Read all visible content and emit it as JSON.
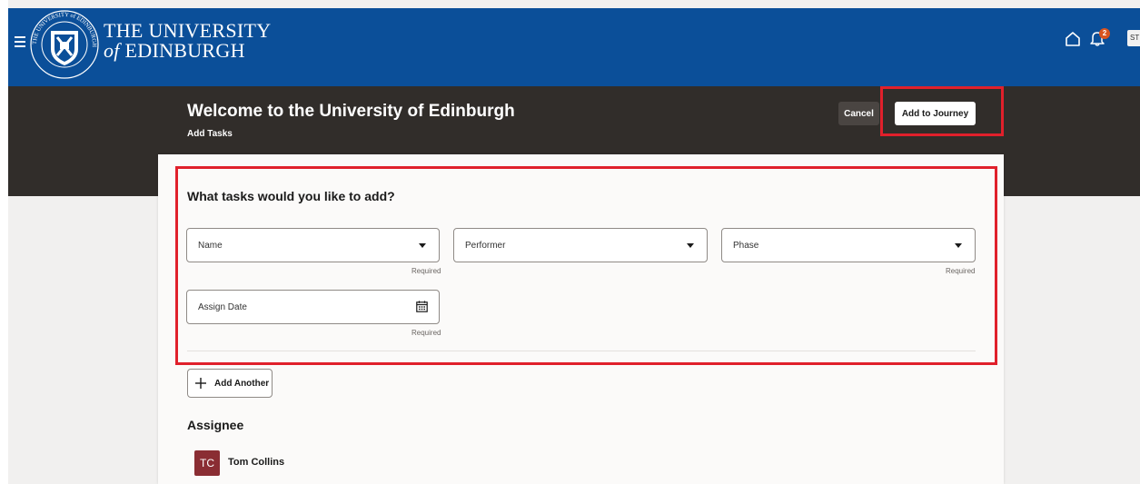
{
  "header": {
    "brand_line1": "THE UNIVERSITY",
    "brand_of": "of",
    "brand_line2": "EDINBURGH",
    "crest_text": "THE UNIVERSITY of EDINBURGH",
    "notification_count": "2",
    "user_initials": "ST",
    "colors": {
      "header_bg": "#0b4f99",
      "badge": "#d9541e"
    }
  },
  "banner": {
    "title": "Welcome to the University of Edinburgh",
    "subtitle": "Add Tasks",
    "cancel_label": "Cancel",
    "add_to_journey_label": "Add to Journey"
  },
  "form": {
    "title": "What tasks would you like to add?",
    "fields": [
      {
        "label": "Name",
        "helper": "Required"
      },
      {
        "label": "Performer",
        "helper": ""
      },
      {
        "label": "Phase",
        "helper": "Required"
      },
      {
        "label": "Assign Date",
        "helper": "Required"
      }
    ],
    "add_another_label": "Add Another"
  },
  "assignee": {
    "title": "Assignee",
    "initials": "TC",
    "name": "Tom Collins"
  },
  "icons": [
    "menu-icon",
    "crest-logo",
    "home-icon",
    "bell-icon",
    "calendar-icon",
    "plus-icon"
  ],
  "highlight_color": "#e0202b"
}
